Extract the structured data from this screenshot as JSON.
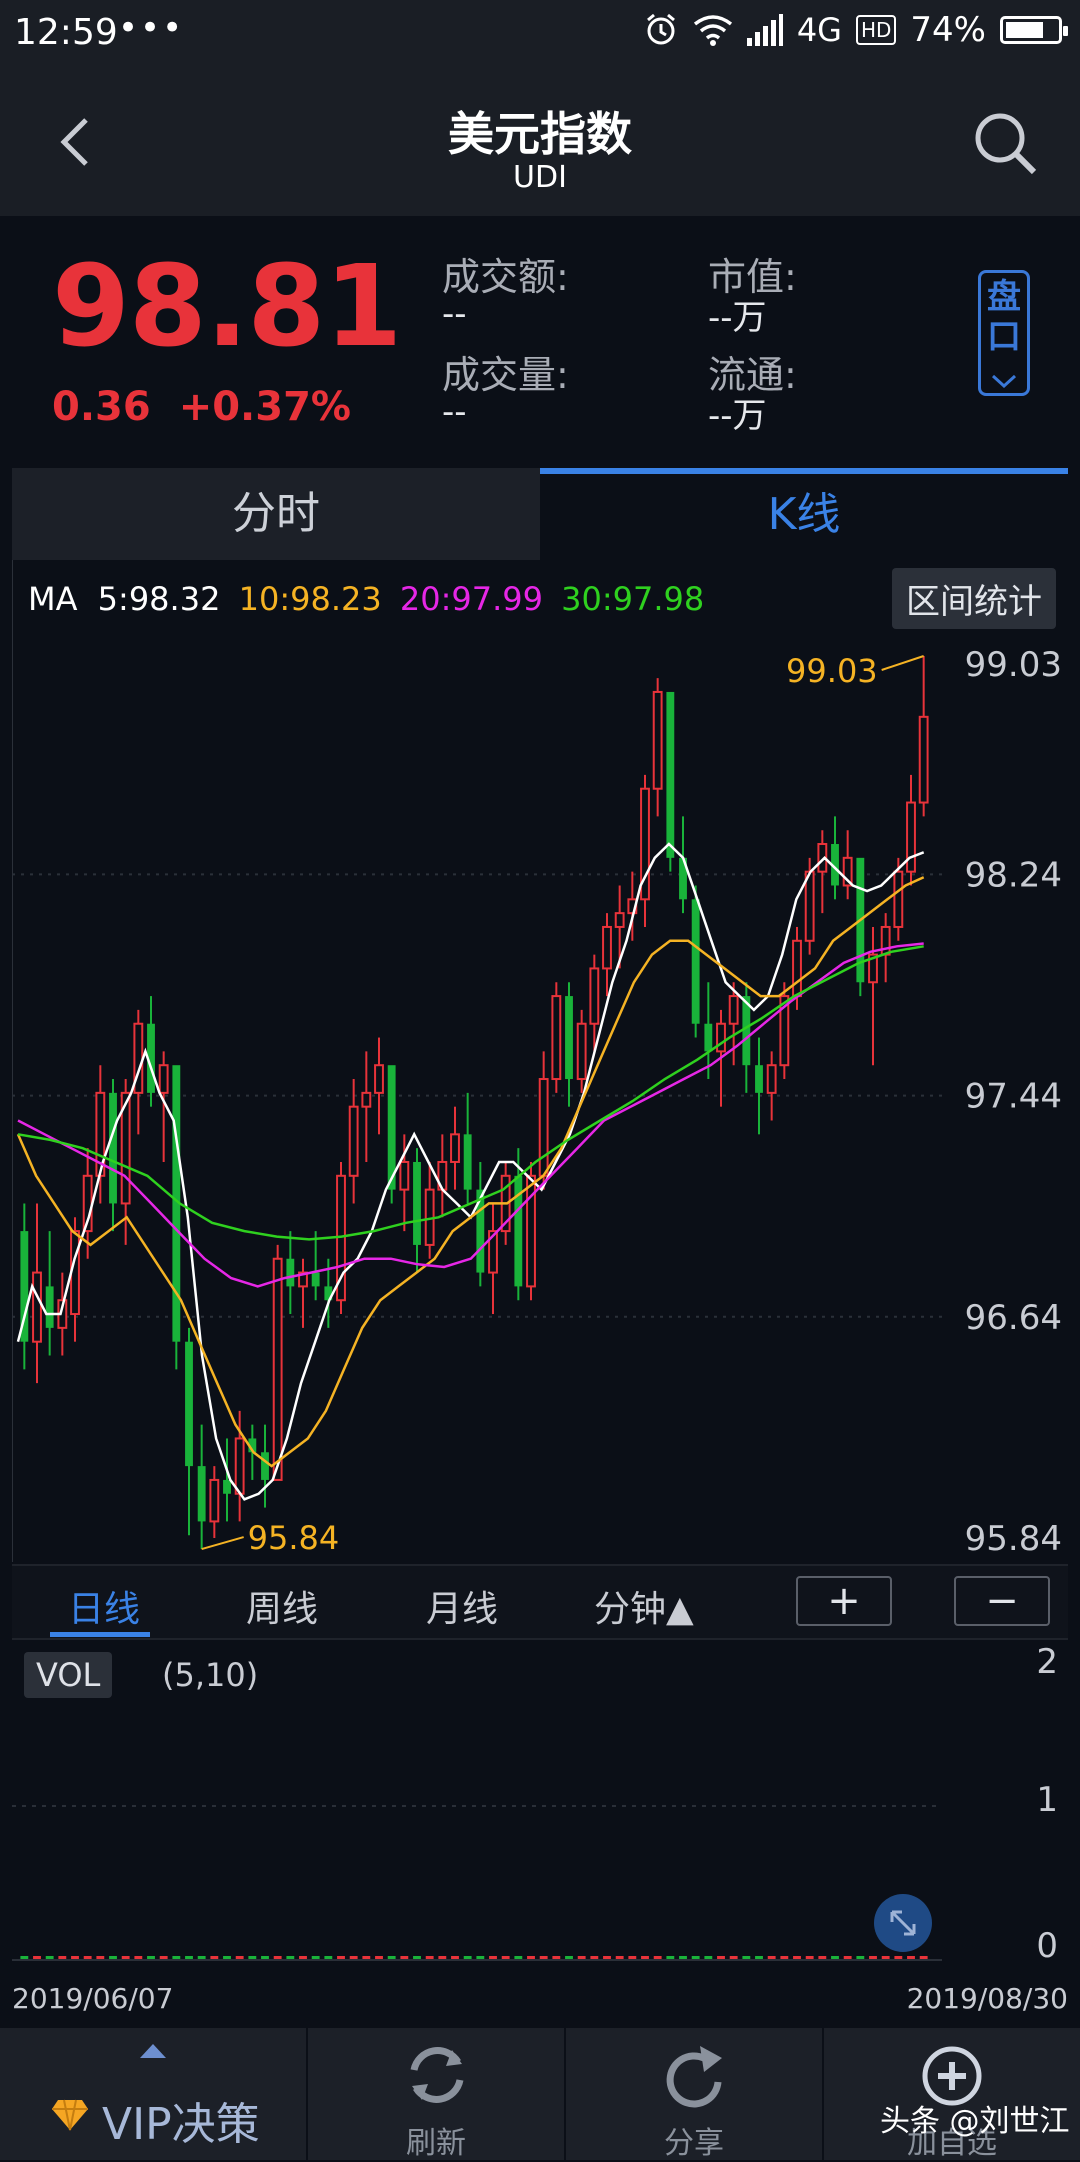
{
  "status_bar": {
    "time": "12:59",
    "dots": "•••",
    "network": "4G",
    "hd": "HD",
    "battery_pct": "74%",
    "battery_level": 0.74
  },
  "header": {
    "title": "美元指数",
    "subtitle": "UDI"
  },
  "quote": {
    "price": "98.81",
    "change": "0.36",
    "change_pct": "+0.37%",
    "turnover_label": "成交额:",
    "turnover_value": "--",
    "volume_label": "成交量:",
    "volume_value": "--",
    "mktcap_label": "市值:",
    "mktcap_value": "--万",
    "float_label": "流通:",
    "float_value": "--万",
    "pankou_label": "盘口"
  },
  "tabs": [
    {
      "label": "分时"
    },
    {
      "label": "K线"
    }
  ],
  "ma": {
    "label": "MA",
    "ma5": "5:98.32",
    "ma10": "10:98.23",
    "ma20": "20:97.99",
    "ma30": "30:97.98"
  },
  "range_button": "区间统计",
  "period": {
    "day": "日线",
    "week": "周线",
    "month": "月线",
    "minute": "分钟▲",
    "zoom_in": "+",
    "zoom_out": "−"
  },
  "volume": {
    "tag": "VOL",
    "params": "(5,10)",
    "axis": [
      "2",
      "1",
      "0"
    ]
  },
  "dates": {
    "start": "2019/06/07",
    "end": "2019/08/30"
  },
  "bottom_bar": {
    "vip": "VIP决策",
    "refresh": "刷新",
    "share": "分享",
    "add": "加自选"
  },
  "watermark": "头条 @刘世江",
  "colors": {
    "up": "#e8333a",
    "down": "#19b33a",
    "accent": "#3a82e6",
    "ma5": "#ffffff",
    "ma10": "#f5b324",
    "ma20": "#e627e6",
    "ma30": "#2fd11f"
  },
  "chart_data": {
    "type": "candlestick",
    "ylim": [
      95.84,
      99.03
    ],
    "y_ticks": [
      "99.03",
      "98.24",
      "97.44",
      "96.64",
      "95.84"
    ],
    "high_label": "99.03",
    "low_label": "95.84",
    "x_range": [
      "2019/06/07",
      "2019/08/30"
    ],
    "candles": [
      [
        96.95,
        97.05,
        96.45,
        96.55
      ],
      [
        96.55,
        97.05,
        96.4,
        96.8
      ],
      [
        96.75,
        96.95,
        96.5,
        96.6
      ],
      [
        96.6,
        96.8,
        96.5,
        96.7
      ],
      [
        96.65,
        97.0,
        96.55,
        96.95
      ],
      [
        96.95,
        97.25,
        96.85,
        97.15
      ],
      [
        97.15,
        97.55,
        97.05,
        97.45
      ],
      [
        97.45,
        97.5,
        96.95,
        97.05
      ],
      [
        97.05,
        97.5,
        96.9,
        97.45
      ],
      [
        97.45,
        97.75,
        97.3,
        97.7
      ],
      [
        97.7,
        97.8,
        97.4,
        97.45
      ],
      [
        97.45,
        97.6,
        97.2,
        97.55
      ],
      [
        97.55,
        97.5,
        96.45,
        96.55
      ],
      [
        96.55,
        96.6,
        95.85,
        96.1
      ],
      [
        96.1,
        96.25,
        95.8,
        95.9
      ],
      [
        95.9,
        96.1,
        95.84,
        96.05
      ],
      [
        96.05,
        96.2,
        95.9,
        96.0
      ],
      [
        96.0,
        96.3,
        95.9,
        96.2
      ],
      [
        96.2,
        96.25,
        96.05,
        96.15
      ],
      [
        96.15,
        96.25,
        95.95,
        96.05
      ],
      [
        96.05,
        96.9,
        96.05,
        96.85
      ],
      [
        96.85,
        96.95,
        96.65,
        96.75
      ],
      [
        96.75,
        96.85,
        96.6,
        96.8
      ],
      [
        96.8,
        96.95,
        96.7,
        96.75
      ],
      [
        96.75,
        96.85,
        96.6,
        96.7
      ],
      [
        96.7,
        97.2,
        96.65,
        97.15
      ],
      [
        97.15,
        97.5,
        97.05,
        97.4
      ],
      [
        97.4,
        97.6,
        97.2,
        97.45
      ],
      [
        97.45,
        97.65,
        97.3,
        97.55
      ],
      [
        97.55,
        97.35,
        97.05,
        97.1
      ],
      [
        97.1,
        97.3,
        96.95,
        97.2
      ],
      [
        97.2,
        97.25,
        96.8,
        96.9
      ],
      [
        96.9,
        97.2,
        96.85,
        97.1
      ],
      [
        97.1,
        97.3,
        97.0,
        97.2
      ],
      [
        97.2,
        97.4,
        97.1,
        97.3
      ],
      [
        97.3,
        97.45,
        97.05,
        97.1
      ],
      [
        97.1,
        97.2,
        96.75,
        96.8
      ],
      [
        96.8,
        97.05,
        96.65,
        96.95
      ],
      [
        96.95,
        97.2,
        96.9,
        97.15
      ],
      [
        97.15,
        97.25,
        96.7,
        96.75
      ],
      [
        96.75,
        97.2,
        96.7,
        97.15
      ],
      [
        97.15,
        97.6,
        97.1,
        97.5
      ],
      [
        97.5,
        97.85,
        97.45,
        97.8
      ],
      [
        97.8,
        97.85,
        97.4,
        97.5
      ],
      [
        97.5,
        97.75,
        97.45,
        97.7
      ],
      [
        97.7,
        97.95,
        97.6,
        97.9
      ],
      [
        97.9,
        98.1,
        97.8,
        98.05
      ],
      [
        98.05,
        98.2,
        97.9,
        98.1
      ],
      [
        98.1,
        98.25,
        98.0,
        98.15
      ],
      [
        98.15,
        98.6,
        98.05,
        98.55
      ],
      [
        98.55,
        98.95,
        98.45,
        98.9
      ],
      [
        98.9,
        98.85,
        98.25,
        98.3
      ],
      [
        98.3,
        98.45,
        98.1,
        98.15
      ],
      [
        98.15,
        98.2,
        97.65,
        97.7
      ],
      [
        97.7,
        97.85,
        97.5,
        97.6
      ],
      [
        97.6,
        97.75,
        97.4,
        97.7
      ],
      [
        97.7,
        97.85,
        97.55,
        97.8
      ],
      [
        97.8,
        97.85,
        97.45,
        97.55
      ],
      [
        97.55,
        97.65,
        97.3,
        97.45
      ],
      [
        97.45,
        97.6,
        97.35,
        97.55
      ],
      [
        97.55,
        97.85,
        97.5,
        97.8
      ],
      [
        97.8,
        98.05,
        97.75,
        98.0
      ],
      [
        98.0,
        98.3,
        97.95,
        98.25
      ],
      [
        98.25,
        98.4,
        98.1,
        98.35
      ],
      [
        98.35,
        98.45,
        98.15,
        98.2
      ],
      [
        98.2,
        98.4,
        98.15,
        98.3
      ],
      [
        98.3,
        98.25,
        97.8,
        97.85
      ],
      [
        97.85,
        98.05,
        97.55,
        97.95
      ],
      [
        97.95,
        98.1,
        97.85,
        98.05
      ],
      [
        98.05,
        98.3,
        98.0,
        98.25
      ],
      [
        98.25,
        98.6,
        98.2,
        98.5
      ],
      [
        98.5,
        99.03,
        98.45,
        98.81
      ]
    ],
    "series": [
      {
        "name": "MA5",
        "values": [
          96.55,
          96.75,
          96.65,
          96.65,
          96.85,
          97.0,
          97.2,
          97.35,
          97.45,
          97.6,
          97.45,
          97.35,
          97.0,
          96.5,
          96.2,
          96.05,
          95.98,
          96.0,
          96.05,
          96.2,
          96.4,
          96.55,
          96.7,
          96.8,
          96.85,
          96.95,
          97.1,
          97.2,
          97.3,
          97.2,
          97.1,
          97.05,
          97.0,
          97.1,
          97.2,
          97.2,
          97.15,
          97.1,
          97.2,
          97.3,
          97.45,
          97.65,
          97.85,
          98.0,
          98.2,
          98.3,
          98.35,
          98.3,
          98.15,
          98.0,
          97.85,
          97.8,
          97.75,
          97.8,
          97.95,
          98.15,
          98.25,
          98.3,
          98.25,
          98.2,
          98.18,
          98.2,
          98.25,
          98.3,
          98.32
        ]
      },
      {
        "name": "MA10",
        "values": [
          97.3,
          97.15,
          97.05,
          96.95,
          96.9,
          96.95,
          97.0,
          96.9,
          96.8,
          96.7,
          96.55,
          96.4,
          96.25,
          96.15,
          96.1,
          96.15,
          96.2,
          96.3,
          96.45,
          96.6,
          96.7,
          96.75,
          96.8,
          96.85,
          96.95,
          97.0,
          97.05,
          97.05,
          97.1,
          97.15,
          97.25,
          97.4,
          97.55,
          97.7,
          97.85,
          97.95,
          98.0,
          98.0,
          97.95,
          97.9,
          97.85,
          97.8,
          97.8,
          97.85,
          97.9,
          98.0,
          98.05,
          98.1,
          98.15,
          98.2,
          98.23
        ]
      },
      {
        "name": "MA20",
        "values": [
          97.35,
          97.3,
          97.25,
          97.2,
          97.15,
          97.05,
          96.95,
          96.85,
          96.78,
          96.75,
          96.78,
          96.8,
          96.82,
          96.85,
          96.85,
          96.83,
          96.82,
          96.85,
          96.95,
          97.05,
          97.15,
          97.25,
          97.35,
          97.4,
          97.45,
          97.5,
          97.55,
          97.62,
          97.7,
          97.78,
          97.85,
          97.92,
          97.96,
          97.98,
          97.99
        ]
      },
      {
        "name": "MA30",
        "values": [
          97.3,
          97.28,
          97.25,
          97.2,
          97.15,
          97.05,
          96.98,
          96.95,
          96.93,
          96.92,
          96.93,
          96.95,
          96.98,
          97.0,
          97.05,
          97.1,
          97.2,
          97.28,
          97.35,
          97.42,
          97.5,
          97.57,
          97.65,
          97.72,
          97.8,
          97.86,
          97.92,
          97.96,
          97.98
        ]
      }
    ]
  }
}
